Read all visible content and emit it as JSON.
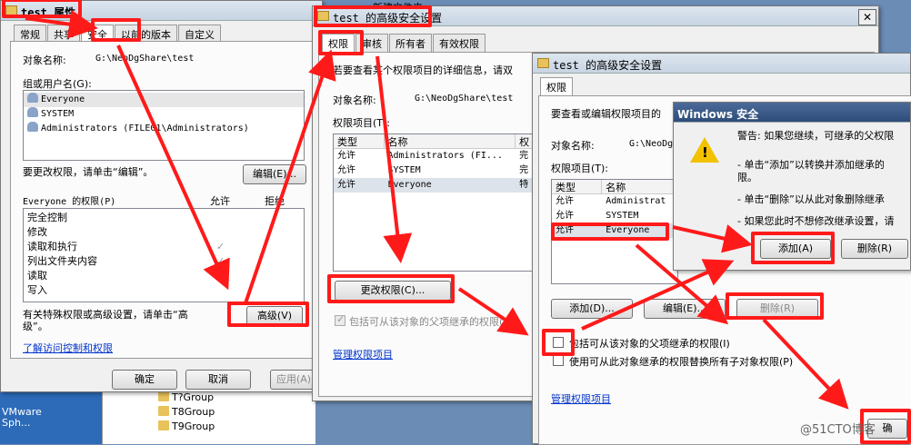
{
  "desktop": {
    "vmware_line1": "VMware",
    "vmware_line2": "Sph...",
    "new_folder_label": "新建文件夹",
    "folders": [
      "T8Group",
      "T9Group",
      "T?Group"
    ],
    "watermark": "@51CTO博客"
  },
  "props": {
    "title": "test 属性",
    "tabs": [
      "常规",
      "共享",
      "安全",
      "以前的版本",
      "自定义"
    ],
    "selected_tab": "安全",
    "object_name_label": "对象名称:",
    "object_name_value": "G:\\NeoDgShare\\test",
    "group_label": "组或用户名(G):",
    "principals": [
      "Everyone",
      "SYSTEM",
      "Administrators (FILE01\\Administrators)"
    ],
    "change_hint": "要更改权限，请单击“编辑”。",
    "edit_button": "编辑(E)...",
    "perm_label": "Everyone 的权限(P)",
    "allow_header": "允许",
    "deny_header": "拒绝",
    "permissions": [
      {
        "name": "完全控制",
        "allow": false
      },
      {
        "name": "修改",
        "allow": false
      },
      {
        "name": "读取和执行",
        "allow": true
      },
      {
        "name": "列出文件夹内容",
        "allow": true
      },
      {
        "name": "读取",
        "allow": true
      },
      {
        "name": "写入",
        "allow": false
      }
    ],
    "special_hint_1": "有关特殊权限或高级设置，请单击“高",
    "special_hint_2": "级”。",
    "advanced_button": "高级(V)",
    "learn_link": "了解访问控制和权限",
    "ok_button": "确定",
    "cancel_button": "取消",
    "apply_button": "应用(A)"
  },
  "adv1": {
    "title": "test 的高级安全设置",
    "close": "✕",
    "tabs": [
      "权限",
      "审核",
      "所有者",
      "有效权限"
    ],
    "intro": "若要查看某个权限项目的详细信息，请双",
    "object_name_label": "对象名称:",
    "object_name_value": "G:\\NeoDgShare\\test",
    "entries_label": "权限项目(T):",
    "columns": [
      "类型",
      "名称",
      "权"
    ],
    "entries": [
      {
        "type": "允许",
        "name": "Administrators (FI...",
        "perm": "完"
      },
      {
        "type": "允许",
        "name": "SYSTEM",
        "perm": "完"
      },
      {
        "type": "允许",
        "name": "Everyone",
        "perm": "特"
      }
    ],
    "change_button": "更改权限(C)...",
    "inherit_label": "包括可从该对象的父项继承的权限(I)",
    "manage_link": "管理权限项目"
  },
  "adv2": {
    "title": "test 的高级安全设置",
    "tab": "权限",
    "intro": "要查看或编辑权限项目的",
    "object_name_label": "对象名称:",
    "object_name_value": "G:\\NeoDg",
    "entries_label": "权限项目(T):",
    "columns": [
      "类型",
      "名称"
    ],
    "entries": [
      {
        "type": "允许",
        "name": "Administrat"
      },
      {
        "type": "允许",
        "name": "SYSTEM"
      },
      {
        "type": "允许",
        "name": "Everyone"
      }
    ],
    "add_button": "添加(D)...",
    "edit_button": "编辑(E)...",
    "remove_button": "删除(R)",
    "inherit_label": "包括可从该对象的父项继承的权限(I)",
    "replace_label": "使用可从此对象继承的权限替换所有子对象权限(P)",
    "manage_link": "管理权限项目",
    "ok_button": "确"
  },
  "security": {
    "title": "Windows 安全",
    "warning": "警告: 如果您继续，可继承的父权限",
    "line1a": "- 单击“添加”以转换并添加继承的",
    "line1b": "限。",
    "line2": "- 单击“删除”以从此对象删除继承",
    "line3": "- 如果您此时不想修改继承设置，请",
    "add_button": "添加(A)",
    "remove_button": "删除(R)"
  }
}
